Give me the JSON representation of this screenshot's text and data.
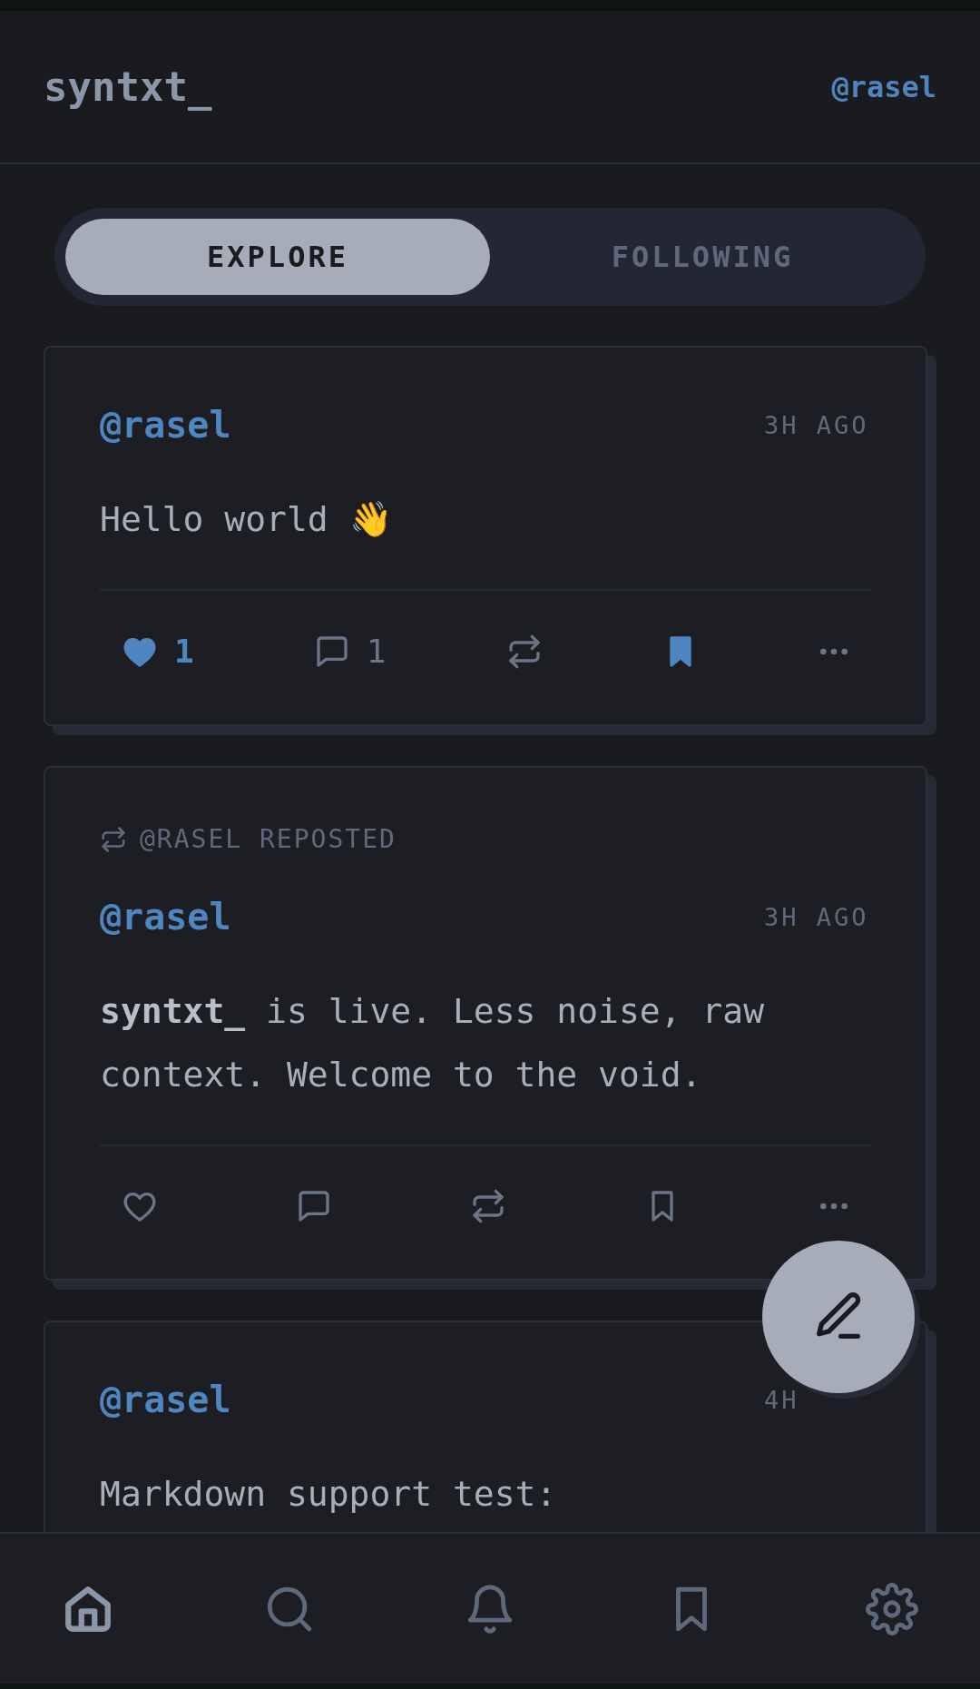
{
  "header": {
    "logo": "syntxt_",
    "user": "@rasel"
  },
  "tabs": [
    {
      "label": "EXPLORE",
      "selected": true
    },
    {
      "label": "FOLLOWING",
      "selected": false
    }
  ],
  "posts": [
    {
      "author": "@rasel",
      "time": "3H AGO",
      "body": "Hello world 👋",
      "actions": {
        "liked": true,
        "like_count": "1",
        "comment_count": "1",
        "reposted": false,
        "bookmarked": true
      }
    },
    {
      "repost_label": "@RASEL REPOSTED",
      "author": "@rasel",
      "time": "3H AGO",
      "body": "**syntxt_** is live. Less noise, raw context. Welcome to the void.",
      "actions": {
        "liked": false,
        "reposted": false,
        "bookmarked": false
      }
    },
    {
      "author": "@rasel",
      "time": "4H",
      "body": "Markdown support test:"
    }
  ],
  "nav": [
    {
      "kind": "home",
      "selected": true
    },
    {
      "kind": "search",
      "selected": false
    },
    {
      "kind": "bell",
      "selected": false
    },
    {
      "kind": "bookmark",
      "selected": false
    },
    {
      "kind": "settings",
      "selected": false
    }
  ]
}
